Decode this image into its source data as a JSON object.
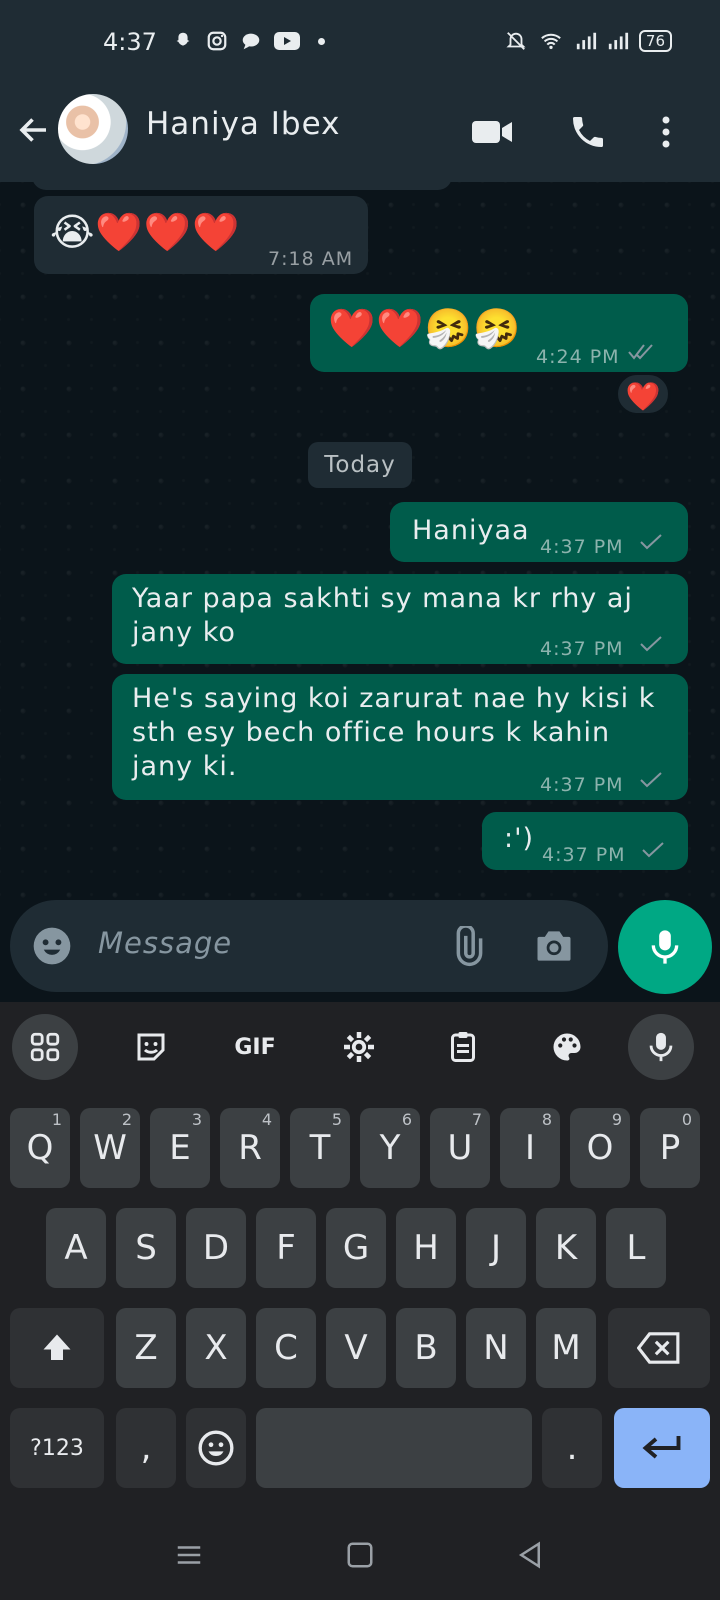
{
  "status_bar": {
    "time": "4:37",
    "battery": "76"
  },
  "header": {
    "contact_name": "Haniya Ibex"
  },
  "messages": [
    {
      "dir": "in",
      "text": "😭❤️❤️❤️",
      "time": "7:18 AM"
    },
    {
      "dir": "out",
      "text": "❤️❤️🤧🤧",
      "time": "4:24 PM",
      "status": "read",
      "reaction": "❤️"
    },
    {
      "dir": "out",
      "text": "Haniyaa",
      "time": "4:37 PM",
      "status": "sent"
    },
    {
      "dir": "out",
      "text_lines": [
        "Yaar papa sakhti sy mana kr rhy aj",
        "jany ko"
      ],
      "time": "4:37 PM",
      "status": "sent"
    },
    {
      "dir": "out",
      "text_lines": [
        "He's saying koi zarurat nae hy kisi k",
        "sth esy bech  office hours k kahin",
        "jany ki."
      ],
      "time": "4:37 PM",
      "status": "sent"
    },
    {
      "dir": "out",
      "text": ":')",
      "time": "4:37 PM",
      "status": "sent"
    }
  ],
  "date_chip": "Today",
  "composer": {
    "placeholder": "Message"
  },
  "keyboard": {
    "toolbar": {
      "gif_label": "GIF"
    },
    "row1": [
      {
        "key": "Q",
        "hint": "1"
      },
      {
        "key": "W",
        "hint": "2"
      },
      {
        "key": "E",
        "hint": "3"
      },
      {
        "key": "R",
        "hint": "4"
      },
      {
        "key": "T",
        "hint": "5"
      },
      {
        "key": "Y",
        "hint": "6"
      },
      {
        "key": "U",
        "hint": "7"
      },
      {
        "key": "I",
        "hint": "8"
      },
      {
        "key": "O",
        "hint": "9"
      },
      {
        "key": "P",
        "hint": "0"
      }
    ],
    "row2": [
      "A",
      "S",
      "D",
      "F",
      "G",
      "H",
      "J",
      "K",
      "L"
    ],
    "row3": [
      "Z",
      "X",
      "C",
      "V",
      "B",
      "N",
      "M"
    ],
    "symbols_label": "?123",
    "comma": ",",
    "period": "."
  },
  "colors": {
    "incoming_bubble": "#1f2c34",
    "outgoing_bubble": "#005c4b",
    "accent": "#00a884",
    "enter_key": "#8ab4f8"
  },
  "icons": [
    "snapchat-icon",
    "instagram-icon",
    "messages-icon",
    "youtube-icon",
    "mute-icon",
    "wifi-icon",
    "signal-icon",
    "battery-icon",
    "back-arrow-icon",
    "video-call-icon",
    "voice-call-icon",
    "more-options-icon",
    "read-ticks-icon",
    "sent-tick-icon",
    "emoji-icon",
    "attach-icon",
    "camera-icon",
    "mic-icon",
    "apps-grid-icon",
    "sticker-icon",
    "settings-icon",
    "clipboard-icon",
    "palette-icon",
    "shift-icon",
    "backspace-icon",
    "enter-icon",
    "nav-menu-icon",
    "nav-home-icon",
    "nav-back-icon"
  ]
}
